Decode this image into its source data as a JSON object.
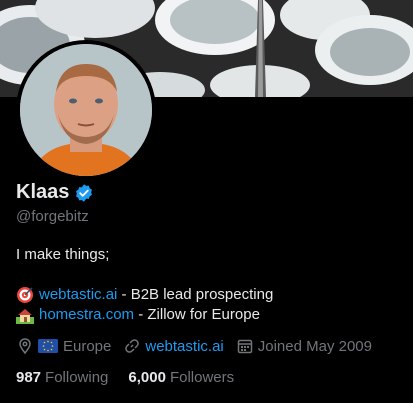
{
  "profile": {
    "name": "Klaas",
    "handle": "@forgebitz",
    "bio_line1": "I make things;",
    "bio_link1": "webtastic.ai",
    "bio_text1": " - B2B lead prospecting",
    "bio_link2": "homestra.com",
    "bio_text2": " - Zillow for Europe"
  },
  "meta": {
    "location": "Europe",
    "website": "webtastic.ai",
    "joined": "Joined May 2009"
  },
  "stats": {
    "following_count": "987",
    "following_label": "Following",
    "followers_count": "6,000",
    "followers_label": "Followers"
  },
  "colors": {
    "background": "#000000",
    "text": "#e7e9ea",
    "muted": "#71767b",
    "link": "#1d9bf0",
    "verified": "#1d9bf0"
  },
  "icons": [
    "verified-icon",
    "target-emoji-icon",
    "house-emoji-icon",
    "location-pin-icon",
    "eu-flag-icon",
    "link-icon",
    "calendar-icon"
  ]
}
